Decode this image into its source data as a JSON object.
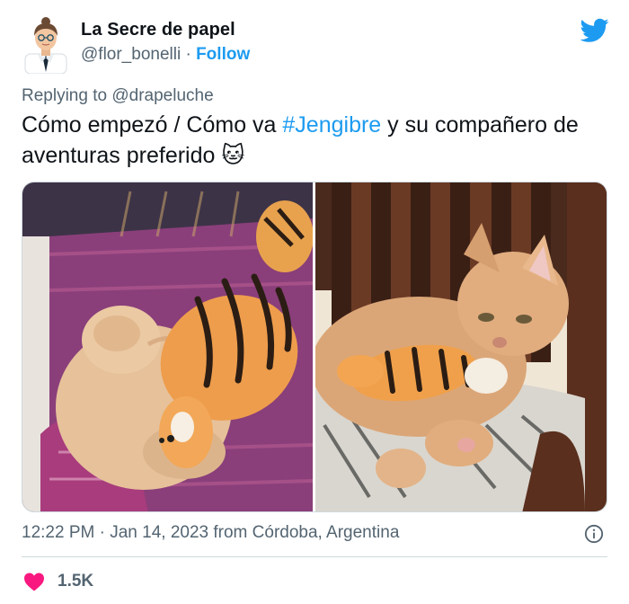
{
  "author": {
    "name": "La Secre de papel",
    "handle": "@flor_bonelli",
    "separator": "·",
    "follow_label": "Follow"
  },
  "reply": {
    "prefix": "Replying to",
    "handle": "@drapeluche"
  },
  "tweet": {
    "text_before": "Cómo empezó / Cómo va ",
    "hashtag": "#Jengibre",
    "text_after": " y su compañero de aventuras preferido ",
    "emoji": "🐱"
  },
  "media": {
    "images": [
      {
        "subject": "kitten-sleeping-with-tiger-plush"
      },
      {
        "subject": "grown-cat-with-tiger-plush-on-chair"
      }
    ]
  },
  "meta": {
    "time": "12:22 PM",
    "dot": "·",
    "date": "Jan 14, 2023",
    "location": "from Córdoba, Argentina"
  },
  "engagement": {
    "likes": "1.5K"
  },
  "colors": {
    "accent": "#1d9bf0",
    "text": "#0f1419",
    "secondary": "#536471",
    "like": "#f91880",
    "border": "#cfd9de"
  },
  "icons": {
    "brand": "twitter-bird-icon",
    "info": "info-icon",
    "like": "heart-icon"
  }
}
